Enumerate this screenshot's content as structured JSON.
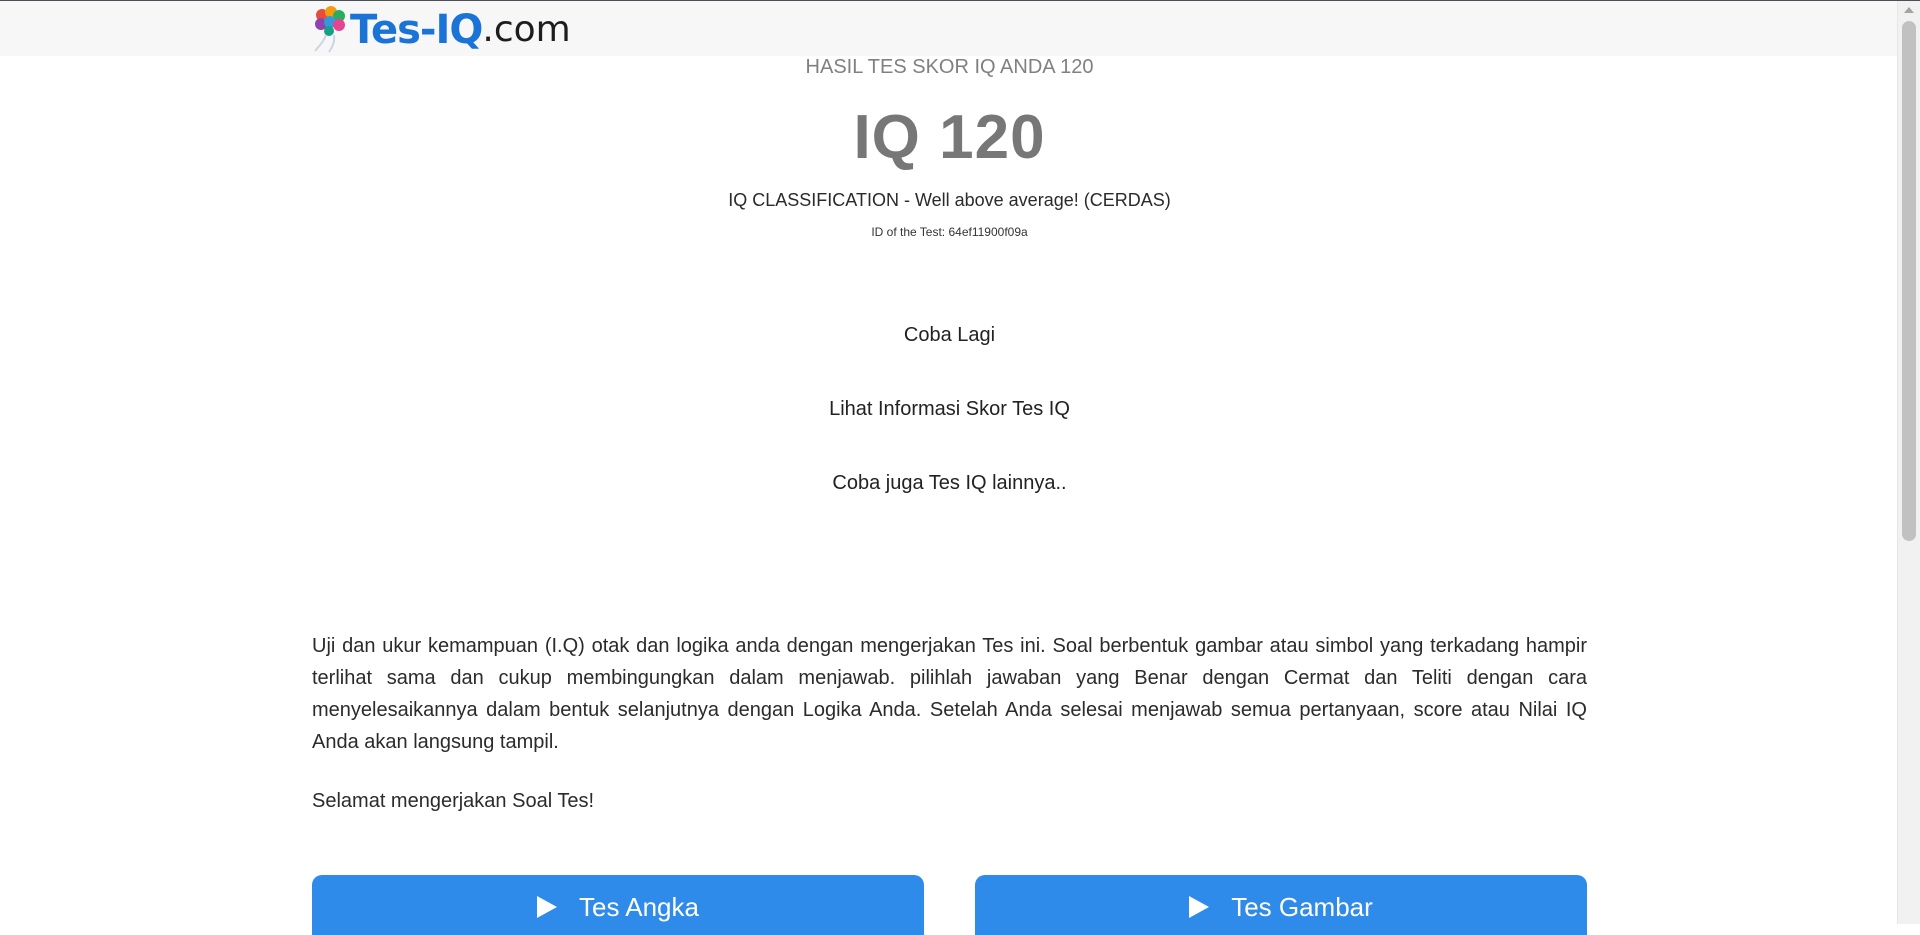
{
  "header": {
    "logo_main": "Tes-IQ",
    "logo_tld": ".com"
  },
  "result": {
    "heading": "HASIL TES SKOR IQ ANDA 120",
    "score": "IQ 120",
    "classification": "IQ CLASSIFICATION - Well above average! (CERDAS)",
    "test_id": "ID of the Test: 64ef11900f09a"
  },
  "links": {
    "retry": "Coba Lagi",
    "info": "Lihat Informasi Skor Tes IQ",
    "other": "Coba juga Tes IQ lainnya.."
  },
  "description": "Uji dan ukur kemampuan (I.Q) otak dan logika anda dengan mengerjakan Tes ini. Soal berbentuk gambar atau simbol yang terkadang hampir terlihat sama dan cukup membingungkan dalam menjawab. pilihlah jawaban yang Benar dengan Cermat dan Teliti dengan cara menyelesaikannya dalam bentuk selanjutnya dengan Logika Anda. Setelah Anda selesai menjawab semua pertanyaan, score atau Nilai IQ Anda akan langsung tampil.",
  "greeting": "Selamat mengerjakan Soal Tes!",
  "buttons": {
    "numbers_test": "Tes Angka",
    "pictures_test": "Tes Gambar"
  },
  "icons": {
    "logo": "brain-logo-icon",
    "play": "play-icon"
  },
  "colors": {
    "brand_blue": "#1a74d8",
    "button_blue": "#2f8bea",
    "score_gray": "#777777"
  }
}
